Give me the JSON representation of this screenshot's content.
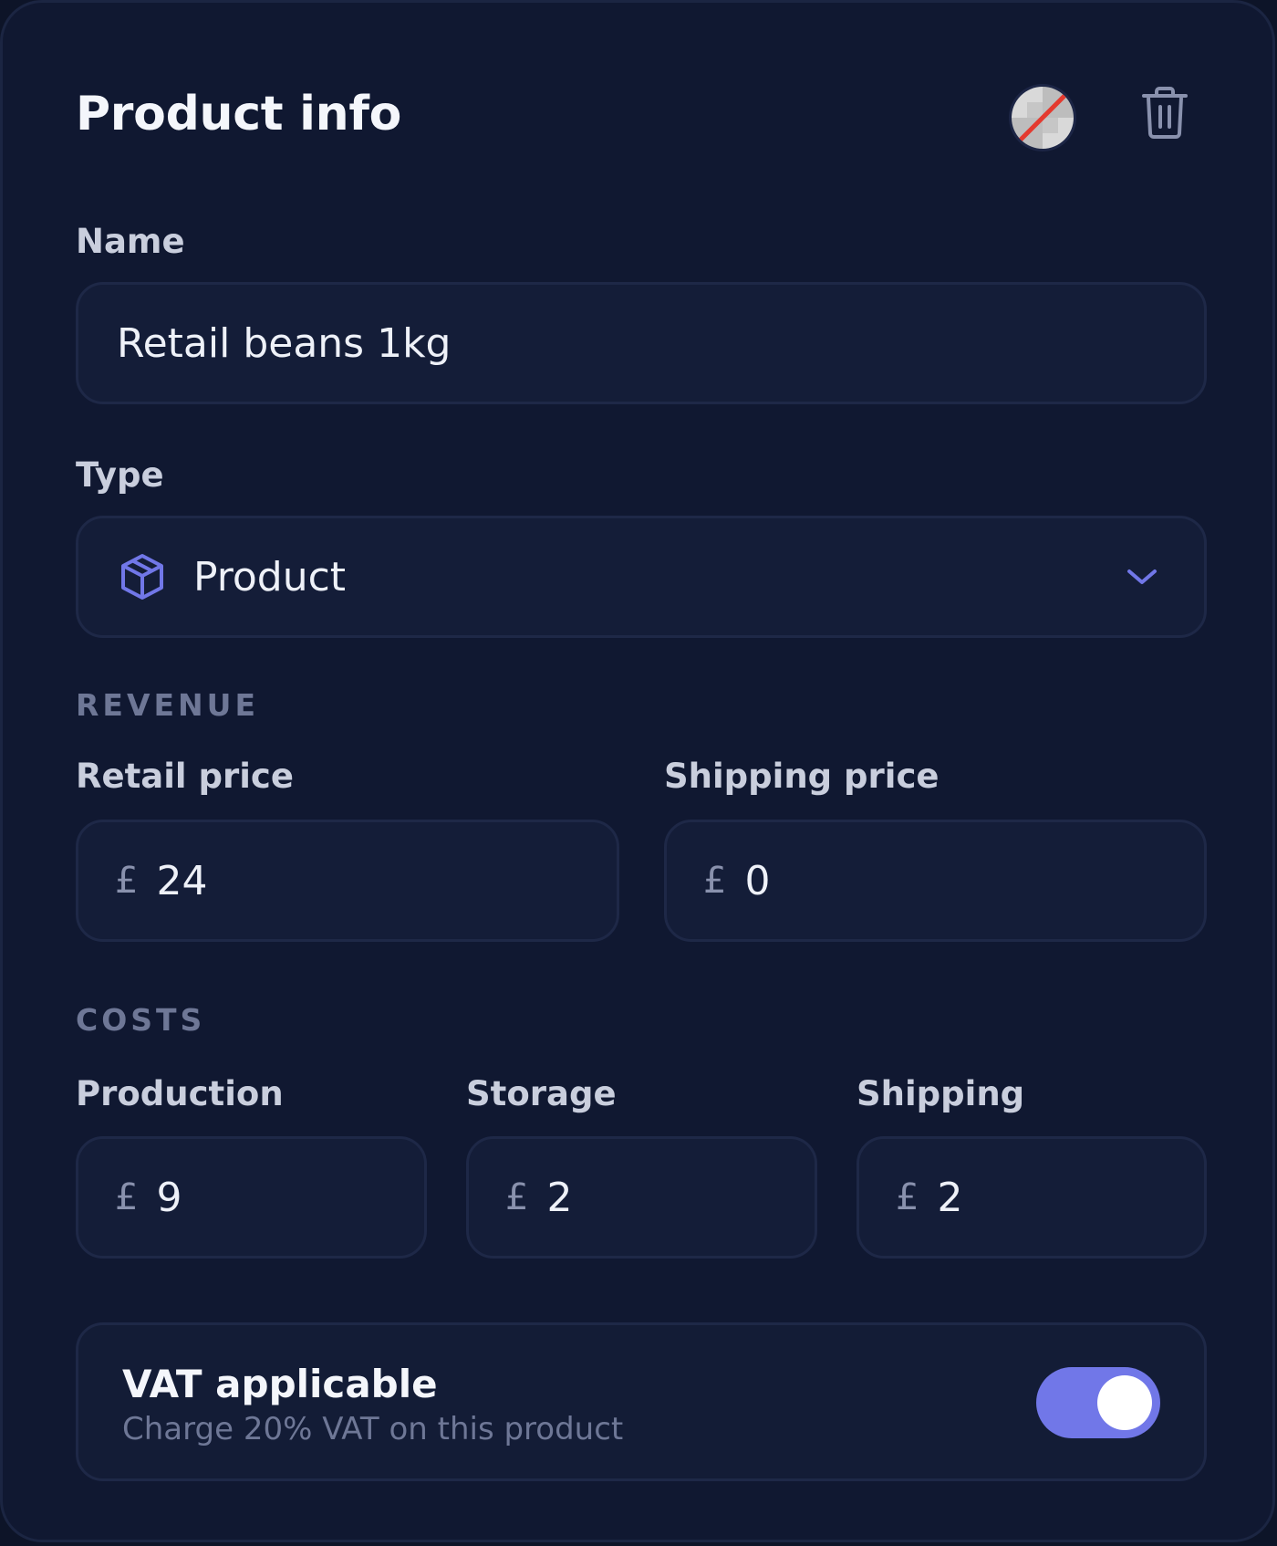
{
  "header": {
    "title": "Product info"
  },
  "name_field": {
    "label": "Name",
    "value": "Retail beans 1kg"
  },
  "type_field": {
    "label": "Type",
    "selected": "Product",
    "icon": "package-icon"
  },
  "revenue": {
    "section_label": "REVENUE",
    "retail_price": {
      "label": "Retail price",
      "currency": "£",
      "value": "24"
    },
    "shipping_price": {
      "label": "Shipping price",
      "currency": "£",
      "value": "0"
    }
  },
  "costs": {
    "section_label": "COSTS",
    "production": {
      "label": "Production",
      "currency": "£",
      "value": "9"
    },
    "storage": {
      "label": "Storage",
      "currency": "£",
      "value": "2"
    },
    "shipping": {
      "label": "Shipping",
      "currency": "£",
      "value": "2"
    }
  },
  "vat": {
    "title": "VAT applicable",
    "subtitle": "Charge 20% VAT on this product",
    "enabled": true
  },
  "colors": {
    "accent": "#7177e8",
    "background": "#101831",
    "field": "#141d38"
  }
}
